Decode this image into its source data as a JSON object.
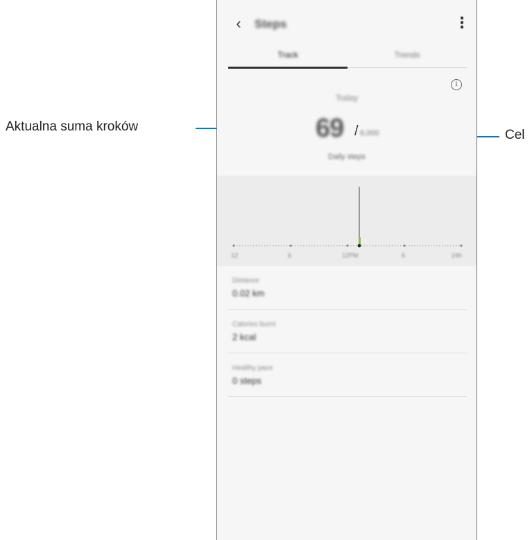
{
  "callouts": {
    "current_total_label": "Aktualna suma kroków",
    "goal_label": "Cel"
  },
  "appbar": {
    "back_icon": "chevron-left",
    "title": "Steps",
    "more_icon": "more-vertical"
  },
  "tabs": [
    {
      "label": "Track",
      "active": true
    },
    {
      "label": "Trends",
      "active": false
    }
  ],
  "summary": {
    "info_icon": "info-circle",
    "info_glyph": "i",
    "day_label": "Today",
    "steps_count": "69",
    "slash": "/",
    "goal": "6,000",
    "caption": "Daily steps"
  },
  "chart": {
    "tick_labels": [
      "12",
      "6",
      "12PM",
      "6",
      "24h"
    ],
    "accent_color": "#8bc34a",
    "axis_color": "#9a9a9a"
  },
  "chart_data": {
    "type": "bar",
    "categories": [
      "12",
      "6",
      "12PM",
      "6",
      "24h"
    ],
    "title": "",
    "xlabel": "",
    "ylabel": ""
  },
  "stats": [
    {
      "label": "Distance",
      "value": "0.02 km"
    },
    {
      "label": "Calories burnt",
      "value": "2 kcal"
    },
    {
      "label": "Healthy pace",
      "value": "0 steps"
    }
  ]
}
